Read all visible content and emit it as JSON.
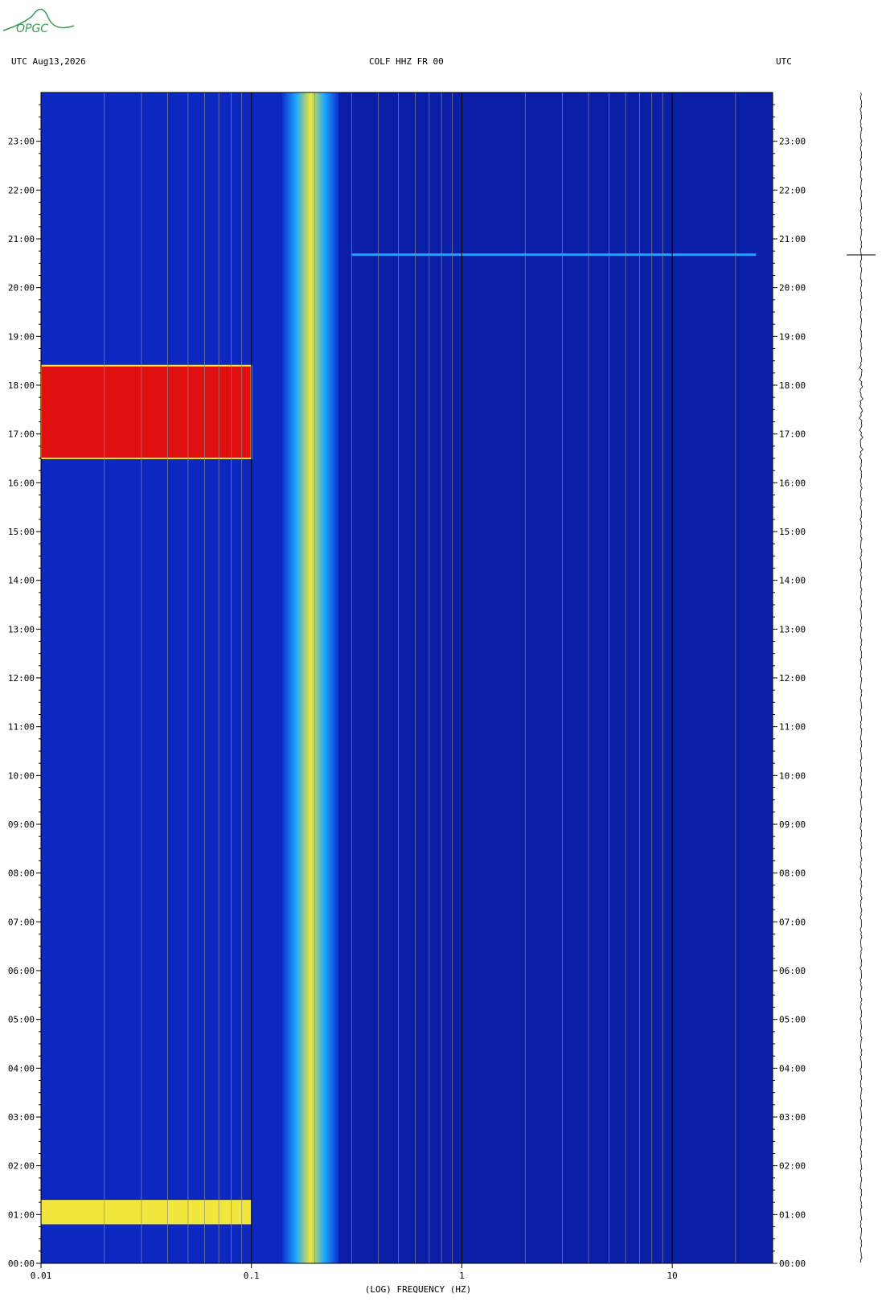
{
  "header": {
    "left": "UTC  Aug13,2026",
    "center": "COLF HHZ FR 00",
    "right": "UTC"
  },
  "logo": {
    "text": "OPGC",
    "color": "#3a9a55"
  },
  "chart_data": {
    "type": "heatmap",
    "xlabel": "(LOG) FREQUENCY (HZ)",
    "x_scale": "log",
    "xlim": [
      0.01,
      30
    ],
    "x_ticks": [
      {
        "value": 0.01,
        "label": "0.01"
      },
      {
        "value": 0.1,
        "label": "0.1"
      },
      {
        "value": 1,
        "label": "1"
      },
      {
        "value": 10,
        "label": "10"
      }
    ],
    "y_ticks": [
      "00:00",
      "01:00",
      "02:00",
      "03:00",
      "04:00",
      "05:00",
      "06:00",
      "07:00",
      "08:00",
      "09:00",
      "10:00",
      "11:00",
      "12:00",
      "13:00",
      "14:00",
      "15:00",
      "16:00",
      "17:00",
      "18:00",
      "19:00",
      "20:00",
      "21:00",
      "22:00",
      "23:00"
    ],
    "ylim_hours": [
      0,
      24
    ],
    "colors": {
      "background": "#0a1ea8",
      "low": "#0f2fd0",
      "mid": "#1aa8ff",
      "high": "#f0e63c",
      "peak": "#e01010"
    },
    "features": [
      {
        "name": "microseism band",
        "freq_range": [
          0.14,
          0.26
        ],
        "hours": [
          0,
          24
        ],
        "level": "high"
      },
      {
        "name": "event",
        "freq_range": [
          0.01,
          0.1
        ],
        "hours": [
          16.5,
          18.4
        ],
        "level": "peak"
      },
      {
        "name": "event",
        "freq_range": [
          0.01,
          0.1
        ],
        "hours": [
          0.8,
          1.3
        ],
        "level": "high"
      },
      {
        "name": "line",
        "freq_range": [
          0.3,
          25
        ],
        "hours": [
          20.65,
          20.7
        ],
        "level": "mid"
      }
    ]
  }
}
